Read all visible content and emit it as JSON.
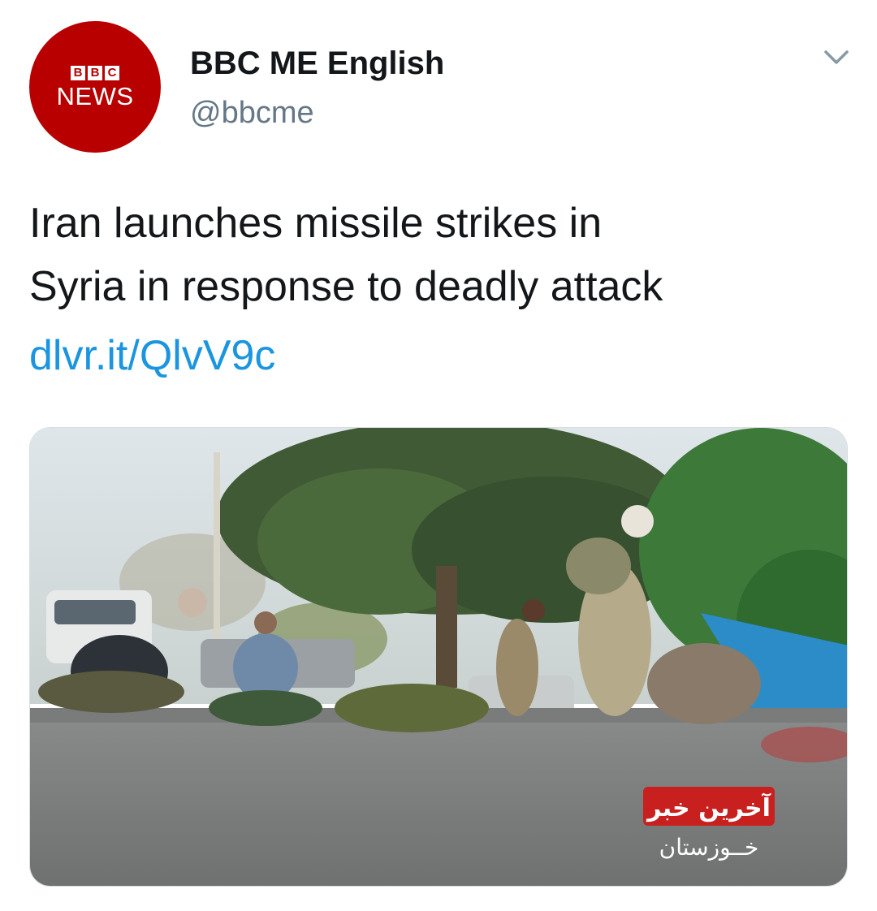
{
  "tweet": {
    "author": {
      "display_name": "BBC ME English",
      "handle": "@bbcme",
      "avatar": {
        "logo_letters": [
          "B",
          "B",
          "C"
        ],
        "logo_word": "NEWS",
        "brand_color": "#b80000"
      }
    },
    "menu_icon": "chevron-down-icon",
    "text_lines": [
      "Iran launches missile strikes in",
      "Syria in response to deadly attack"
    ],
    "link": "dlvr.it/QlvV9c",
    "media": {
      "watermark_title": "آخرین خبر",
      "watermark_subtitle": "خــوزستان"
    }
  },
  "colors": {
    "link": "#1b95e0",
    "handle": "#657786",
    "text": "#14171a"
  }
}
